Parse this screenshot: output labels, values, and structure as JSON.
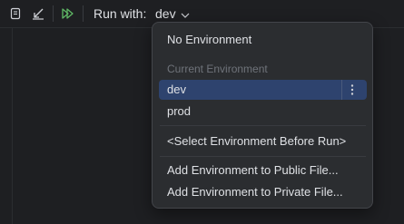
{
  "toolbar": {
    "icons": [
      "copy-icon",
      "collapse-icon",
      "run-all-icon"
    ],
    "run_with_label": "Run with:",
    "env_selected": "dev"
  },
  "popup": {
    "no_env": "No Environment",
    "current_env_header": "Current Environment",
    "envs": [
      "dev",
      "prod"
    ],
    "selected_env": "dev",
    "select_before_run": "<Select Environment Before Run>",
    "add_public": "Add Environment to Public File...",
    "add_private": "Add Environment to Private File..."
  },
  "colors": {
    "background": "#1e1f22",
    "popup_bg": "#2b2d30",
    "selection": "#2e436e",
    "run_icon_green": "#5fb865",
    "muted_text": "#6f737a"
  }
}
